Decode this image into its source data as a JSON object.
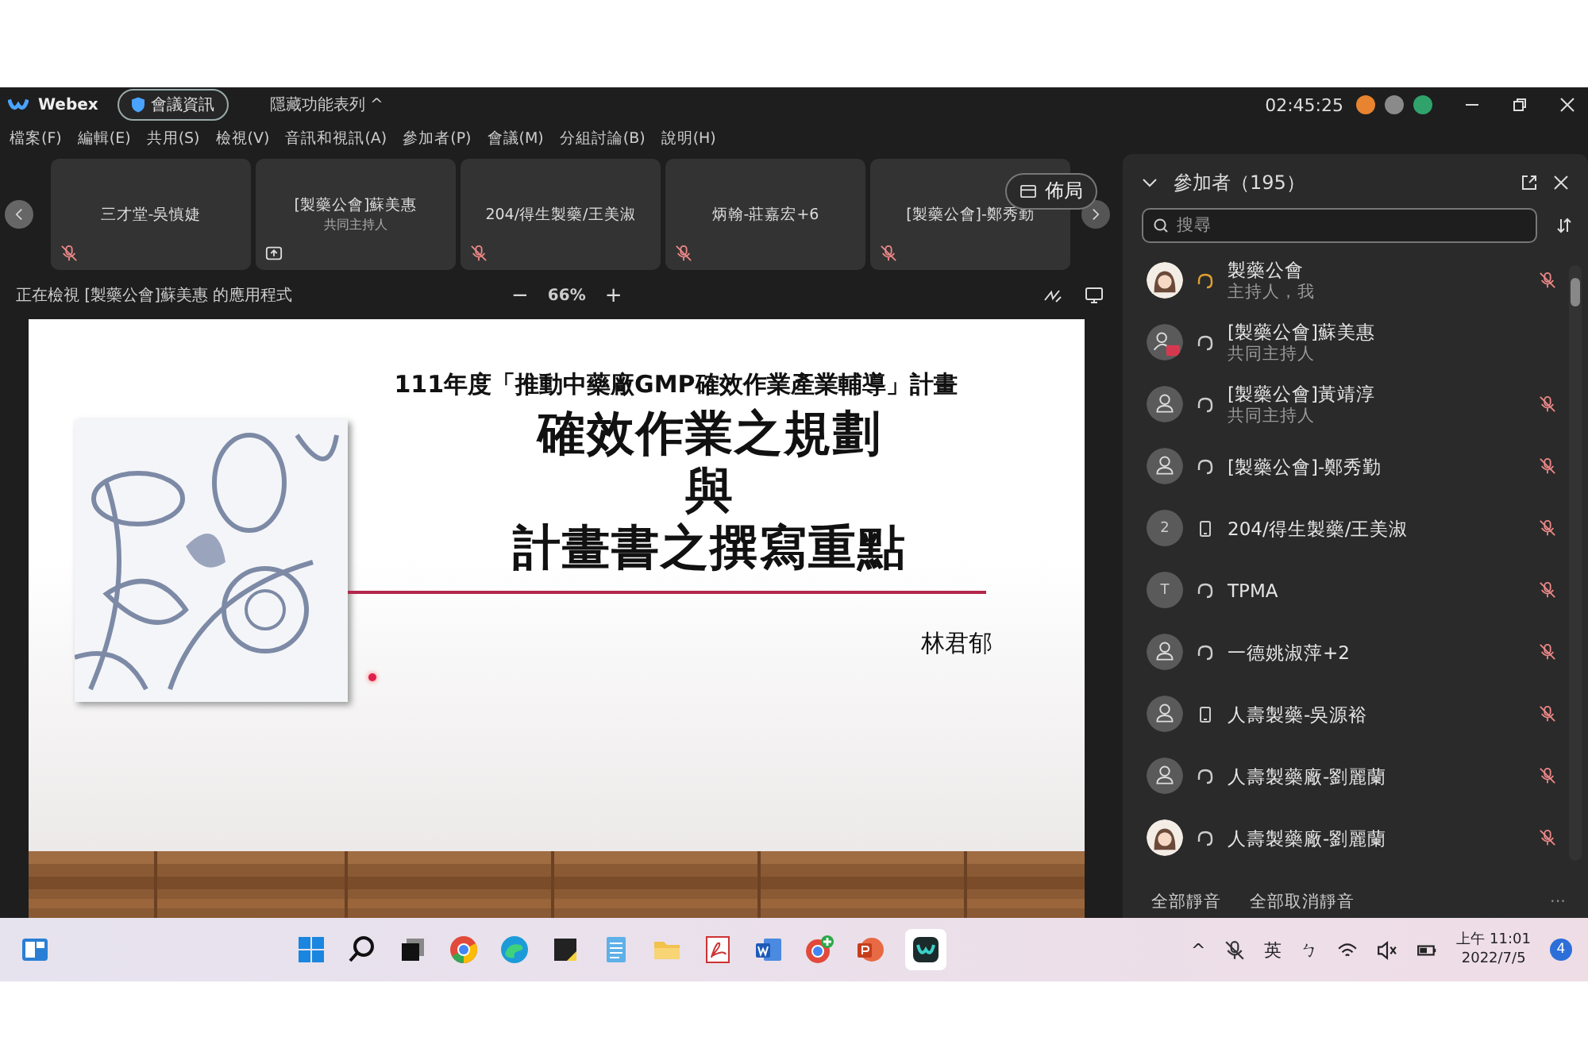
{
  "titlebar": {
    "app": "Webex",
    "meeting_info": "會議資訊",
    "hide_menu": "隱藏功能表列 ^",
    "timer": "02:45:25"
  },
  "menu": [
    "檔案(F)",
    "編輯(E)",
    "共用(S)",
    "檢視(V)",
    "音訊和視訊(A)",
    "參加者(P)",
    "會議(M)",
    "分組討論(B)",
    "說明(H)"
  ],
  "thumbnails": [
    {
      "name": "三才堂-吳慎婕",
      "kind": "muted"
    },
    {
      "name": "[製藥公會]蘇美惠",
      "role": "共同主持人",
      "kind": "sharing"
    },
    {
      "name": "204/得生製藥/王美淑",
      "kind": "muted"
    },
    {
      "name": "炳翰-莊嘉宏+6",
      "kind": "muted"
    },
    {
      "name": "[製藥公會]-鄭秀勤",
      "kind": "muted"
    }
  ],
  "layout_button": "佈局",
  "viewing": {
    "label": "正在檢視 [製藥公會]蘇美惠 的應用程式",
    "zoom": "66%",
    "zoom_out": "−",
    "zoom_in": "+"
  },
  "slide": {
    "subtitle": "111年度「推動中藥廠GMP確效作業產業輔導」計畫",
    "title": [
      "確效作業之規劃",
      "與",
      "計畫書之撰寫重點"
    ],
    "author": "林君郁"
  },
  "participants": {
    "title": "參加者（195）",
    "search": {
      "placeholder": "搜尋"
    },
    "items": [
      {
        "name": "製藥公會",
        "role": "主持人，我",
        "on_phone": false,
        "host": true,
        "muted": true
      },
      {
        "name": "[製藥公會]蘇美惠",
        "role": "共同主持人",
        "kind": "sharing",
        "on_phone": false,
        "host": false,
        "muted": false
      },
      {
        "name": "[製藥公會]黃靖淳",
        "role": "共同主持人",
        "kind": "person",
        "on_phone": false,
        "host": false,
        "muted": true
      },
      {
        "name": "[製藥公會]-鄭秀勤",
        "kind": "person",
        "on_phone": false,
        "host": false,
        "muted": true
      },
      {
        "name": "204/得生製藥/王美淑",
        "kind": "initial",
        "initial": "2",
        "on_phone": true,
        "host": false,
        "muted": true
      },
      {
        "name": "TPMA",
        "kind": "initial",
        "initial": "T",
        "on_phone": false,
        "host": false,
        "muted": true
      },
      {
        "name": "一德姚淑萍+2",
        "kind": "person",
        "on_phone": false,
        "host": false,
        "muted": true
      },
      {
        "name": "人壽製藥-吳源裕",
        "kind": "person",
        "on_phone": true,
        "host": false,
        "muted": true
      },
      {
        "name": "人壽製藥廠-劉麗蘭",
        "kind": "person",
        "on_phone": false,
        "host": false,
        "muted": true
      },
      {
        "name": "人壽製藥廠-劉麗蘭",
        "on_phone": false,
        "host": false,
        "muted": true
      }
    ],
    "mute_all": "全部靜音",
    "unmute_all": "全部取消靜音",
    "more": "···"
  },
  "taskbar": {
    "tray": [
      "^",
      "英",
      "ㄅ"
    ],
    "time": "上午 11:01",
    "date": "2022/7/5",
    "notifications": "4"
  }
}
